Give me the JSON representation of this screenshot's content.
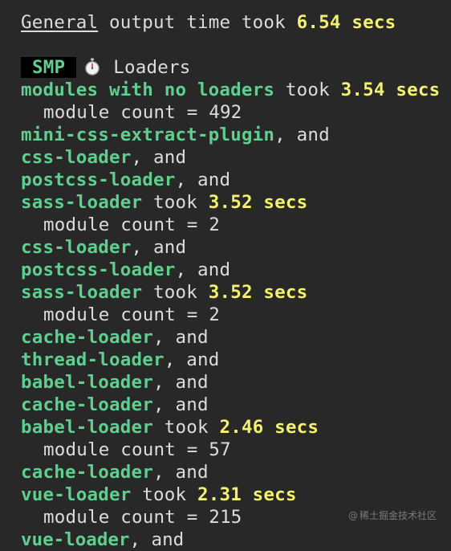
{
  "header": {
    "label": "General",
    "text": " output time took ",
    "time": "6.54 secs"
  },
  "smp": {
    "badge": "SMP",
    "icon": "stopwatch-icon",
    "title": "Loaders"
  },
  "groups": [
    {
      "loaders": [
        "modules with no loaders"
      ],
      "time": "3.54 secs",
      "module_count": "module count = 492"
    },
    {
      "loaders": [
        "mini-css-extract-plugin",
        "css-loader",
        "postcss-loader",
        "sass-loader"
      ],
      "time": "3.52 secs",
      "module_count": "module count = 2"
    },
    {
      "loaders": [
        "css-loader",
        "postcss-loader",
        "sass-loader"
      ],
      "time": "3.52 secs",
      "module_count": "module count = 2"
    },
    {
      "loaders": [
        "cache-loader",
        "thread-loader",
        "babel-loader",
        "cache-loader",
        "babel-loader"
      ],
      "time": "2.46 secs",
      "module_count": "module count = 57"
    },
    {
      "loaders": [
        "cache-loader",
        "vue-loader"
      ],
      "time": "2.31 secs",
      "module_count": "module count = 215"
    }
  ],
  "trailing_line": "vue-loader, and",
  "connectors": {
    "and": ", and",
    "took": " took "
  },
  "watermark": {
    "icon": "at-icon",
    "text": "稀土掘金技术社区"
  },
  "colors": {
    "background": "#282828",
    "loader_green": "#5fcf8f",
    "time_yellow": "#f4f070",
    "text": "#dcdcdc"
  }
}
